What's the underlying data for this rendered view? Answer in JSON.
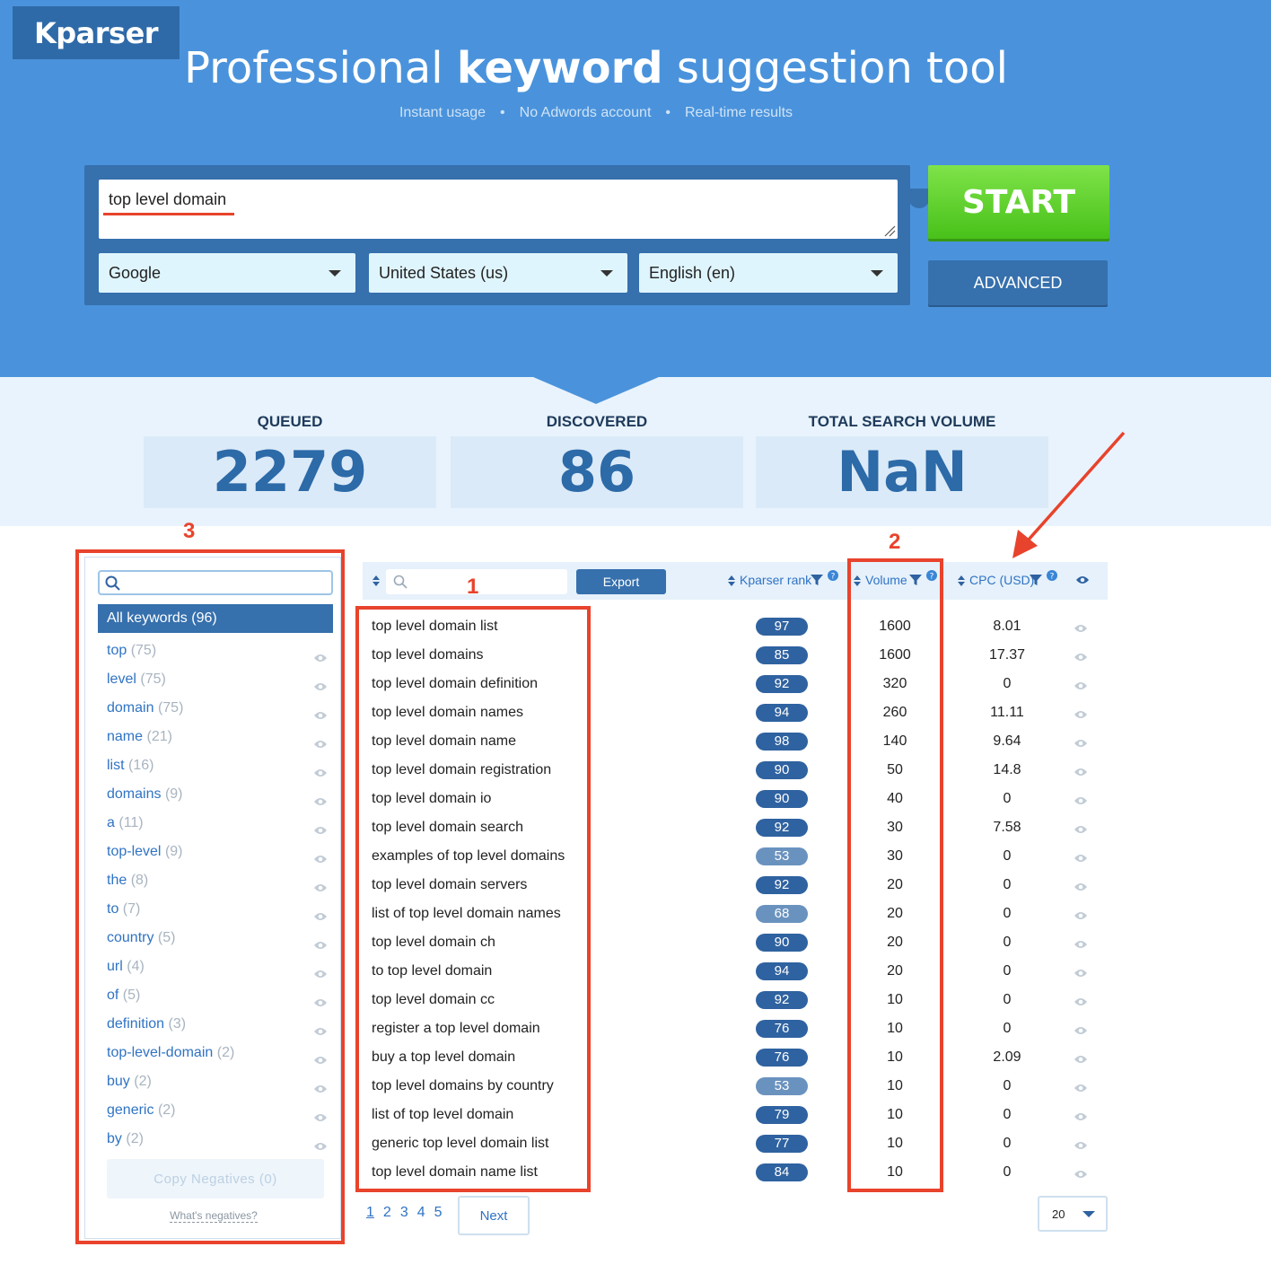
{
  "header": {
    "logo": "Kparser",
    "title_pre": "Professional ",
    "title_bold": "keyword",
    "title_post": " suggestion tool",
    "features": [
      "Instant usage",
      "No Adwords account",
      "Real-time results"
    ],
    "bg_color": "#4a93dc"
  },
  "search": {
    "query": "top level domain",
    "engine": "Google",
    "country": "United States (us)",
    "language": "English (en)",
    "start_label": "START",
    "advanced_label": "ADVANCED"
  },
  "stats": [
    {
      "label": "QUEUED",
      "value": "2279"
    },
    {
      "label": "DISCOVERED",
      "value": "86"
    },
    {
      "label": "TOTAL SEARCH VOLUME",
      "value": "NaN"
    }
  ],
  "sidebar": {
    "all_label": "All keywords (96)",
    "items": [
      {
        "word": "top",
        "count": "(75)"
      },
      {
        "word": "level",
        "count": "(75)"
      },
      {
        "word": "domain",
        "count": "(75)"
      },
      {
        "word": "name",
        "count": "(21)"
      },
      {
        "word": "list",
        "count": "(16)"
      },
      {
        "word": "domains",
        "count": "(9)"
      },
      {
        "word": "a",
        "count": "(11)"
      },
      {
        "word": "top-level",
        "count": "(9)"
      },
      {
        "word": "the",
        "count": "(8)"
      },
      {
        "word": "to",
        "count": "(7)"
      },
      {
        "word": "country",
        "count": "(5)"
      },
      {
        "word": "url",
        "count": "(4)"
      },
      {
        "word": "of",
        "count": "(5)"
      },
      {
        "word": "definition",
        "count": "(3)"
      },
      {
        "word": "top-level-domain",
        "count": "(2)"
      },
      {
        "word": "buy",
        "count": "(2)"
      },
      {
        "word": "generic",
        "count": "(2)"
      },
      {
        "word": "by",
        "count": "(2)"
      }
    ],
    "copy_negatives": "Copy Negatives (0)",
    "whats_negatives": "What's negatives?"
  },
  "table": {
    "export_label": "Export",
    "col_rank": "Kparser rank",
    "col_volume": "Volume",
    "col_cpc": "CPC (USD)",
    "rows": [
      {
        "kw": "top level domain list",
        "rank": "97",
        "vol": "1600",
        "cpc": "8.01"
      },
      {
        "kw": "top level domains",
        "rank": "85",
        "vol": "1600",
        "cpc": "17.37"
      },
      {
        "kw": "top level domain definition",
        "rank": "92",
        "vol": "320",
        "cpc": "0"
      },
      {
        "kw": "top level domain names",
        "rank": "94",
        "vol": "260",
        "cpc": "11.11"
      },
      {
        "kw": "top level domain name",
        "rank": "98",
        "vol": "140",
        "cpc": "9.64"
      },
      {
        "kw": "top level domain registration",
        "rank": "90",
        "vol": "50",
        "cpc": "14.8"
      },
      {
        "kw": "top level domain io",
        "rank": "90",
        "vol": "40",
        "cpc": "0"
      },
      {
        "kw": "top level domain search",
        "rank": "92",
        "vol": "30",
        "cpc": "7.58"
      },
      {
        "kw": "examples of top level domains",
        "rank": "53",
        "vol": "30",
        "cpc": "0"
      },
      {
        "kw": "top level domain servers",
        "rank": "92",
        "vol": "20",
        "cpc": "0"
      },
      {
        "kw": "list of top level domain names",
        "rank": "68",
        "vol": "20",
        "cpc": "0"
      },
      {
        "kw": "top level domain ch",
        "rank": "90",
        "vol": "20",
        "cpc": "0"
      },
      {
        "kw": "to top level domain",
        "rank": "94",
        "vol": "20",
        "cpc": "0"
      },
      {
        "kw": "top level domain cc",
        "rank": "92",
        "vol": "10",
        "cpc": "0"
      },
      {
        "kw": "register a top level domain",
        "rank": "76",
        "vol": "10",
        "cpc": "0"
      },
      {
        "kw": "buy a top level domain",
        "rank": "76",
        "vol": "10",
        "cpc": "2.09"
      },
      {
        "kw": "top level domains by country",
        "rank": "53",
        "vol": "10",
        "cpc": "0"
      },
      {
        "kw": "list of top level domain",
        "rank": "79",
        "vol": "10",
        "cpc": "0"
      },
      {
        "kw": "generic top level domain list",
        "rank": "77",
        "vol": "10",
        "cpc": "0"
      },
      {
        "kw": "top level domain name list",
        "rank": "84",
        "vol": "10",
        "cpc": "0"
      }
    ]
  },
  "pagination": {
    "pages": [
      "1",
      "2",
      "3",
      "4",
      "5"
    ],
    "next_label": "Next",
    "per_page": "20"
  },
  "annotations": {
    "labels": [
      "1",
      "2",
      "3"
    ],
    "color": "#e8432c"
  }
}
